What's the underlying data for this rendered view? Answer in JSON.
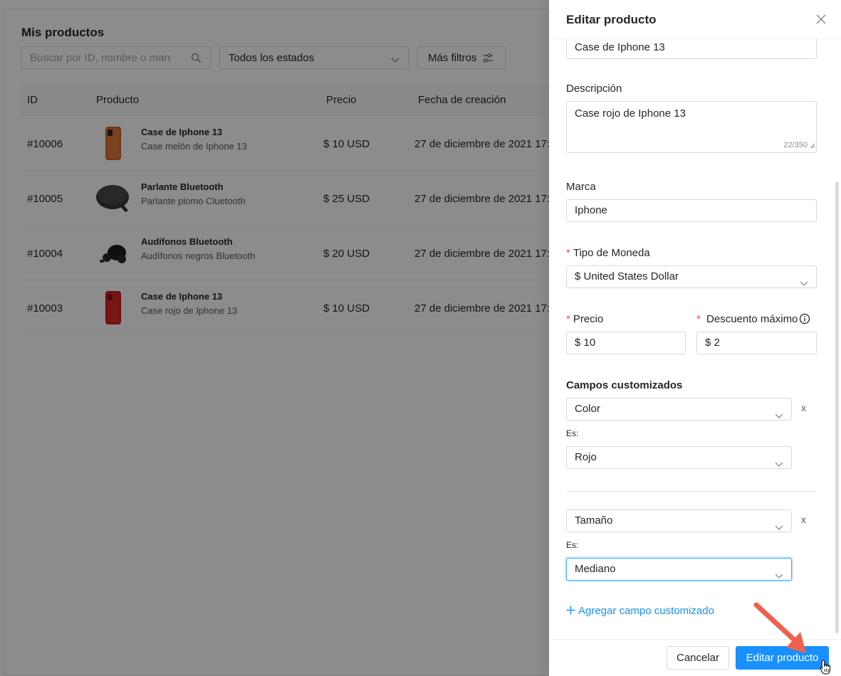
{
  "page": {
    "title": "Mis productos",
    "search_placeholder": "Buscar por ID, nombre o marca",
    "status_filter": "Todos los estados",
    "more_filters_label": "Más filtros",
    "columns": [
      "ID",
      "Producto",
      "Precio",
      "Fecha de creación"
    ],
    "rows": [
      {
        "id": "#10006",
        "name": "Case de Iphone 13",
        "desc": "Case melón de Iphone 13",
        "price": "$ 10 USD",
        "date": "27 de diciembre de 2021 17:",
        "thumb": "orange-phone-case"
      },
      {
        "id": "#10005",
        "name": "Parlante Bluetooth",
        "desc": "Parlante plomo Cluetooth",
        "price": "$ 25 USD",
        "date": "27 de diciembre de 2021 17:",
        "thumb": "bluetooth-speaker"
      },
      {
        "id": "#10004",
        "name": "Audífonos Bluetooth",
        "desc": "Audífonos negros Bluetooth",
        "price": "$ 20 USD",
        "date": "27 de diciembre de 2021 17:",
        "thumb": "earbuds"
      },
      {
        "id": "#10003",
        "name": "Case de Iphone 13",
        "desc": "Case rojo de Iphone 13",
        "price": "$ 10 USD",
        "date": "27 de diciembre de 2021 17:",
        "thumb": "red-phone-case"
      }
    ]
  },
  "drawer": {
    "title": "Editar producto",
    "name_value": "Case de Iphone 13",
    "description_label": "Descripción",
    "description_value": "Case rojo de Iphone 13",
    "description_counter": "22/350",
    "brand_label": "Marca",
    "brand_value": "Iphone",
    "currency_label": "Tipo de Moneda",
    "currency_value": "$ United States Dollar",
    "price_label": "Precio",
    "price_value": "$ 10",
    "discount_label": "Descuento máximo",
    "discount_value": "$ 2",
    "custom_fields_label": "Campos customizados",
    "custom_fields": [
      {
        "field": "Color",
        "is_label": "Es:",
        "value": "Rojo"
      },
      {
        "field": "Tamaño",
        "is_label": "Es:",
        "value": "Mediano"
      }
    ],
    "remove_label": "x",
    "add_custom_field_label": "Agregar campo customizado",
    "cancel_label": "Cancelar",
    "submit_label": "Editar producto",
    "required_mark": "*"
  },
  "colors": {
    "primary": "#1890ff",
    "required": "#ff4d4f",
    "annotation_arrow": "#f0614c",
    "overlay": "rgba(0,0,0,0.45)"
  }
}
